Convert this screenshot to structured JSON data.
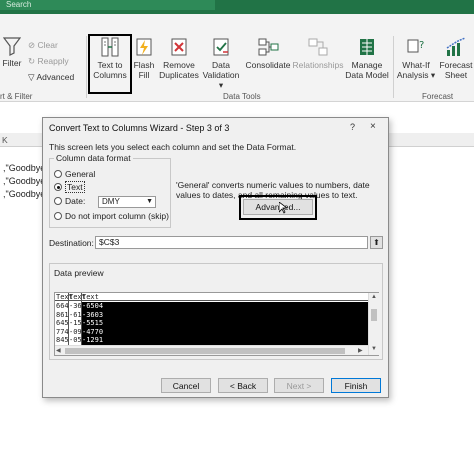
{
  "app": {
    "search_placeholder": "Search",
    "accent": "#217346"
  },
  "ribbon": {
    "filter_label": "Filter",
    "clear_label": "Clear",
    "reapply_label": "Reapply",
    "advanced_label": "Advanced",
    "sort_filter_group": "rt & Filter",
    "text_to_columns_line1": "Text to",
    "text_to_columns_line2": "Columns",
    "flash_fill_line1": "Flash",
    "flash_fill_line2": "Fill",
    "remove_duplicates_line1": "Remove",
    "remove_duplicates_line2": "Duplicates",
    "data_validation_line1": "Data",
    "data_validation_line2": "Validation",
    "consolidate_label": "Consolidate",
    "relationships_label": "Relationships",
    "manage_model_line1": "Manage",
    "manage_model_line2": "Data Model",
    "data_tools_group": "Data Tools",
    "whatif_line1": "What-If",
    "whatif_line2": "Analysis",
    "forecast_sheet_line1": "Forecast",
    "forecast_sheet_line2": "Sheet",
    "forecast_group": "Forecast"
  },
  "sheet": {
    "column_k": "K",
    "rows": [
      ",\"Goodbye",
      ",\"Goodbye",
      ",\"Goodbye"
    ]
  },
  "dialog": {
    "title": "Convert Text to Columns Wizard - Step 3 of 3",
    "help": "?",
    "close": "×",
    "subtitle": "This screen lets you select each column and set the Data Format.",
    "format_group": "Column data format",
    "opt_general": "General",
    "opt_text": "Text",
    "opt_date": "Date:",
    "date_value": "DMY",
    "opt_skip": "Do not import column (skip)",
    "selected_option": "Text",
    "info": "'General' converts numeric values to numbers, date values to dates, and all remaining values to text.",
    "advanced_button": "Advanced...",
    "destination_label": "Destination:",
    "destination_value": "$C$3",
    "preview_label": "Data preview",
    "preview_headers": [
      "Text",
      "Text",
      "Text"
    ],
    "preview_col1": [
      "664",
      "861",
      "645",
      "774",
      "845"
    ],
    "preview_col2": [
      "-36",
      "-61",
      "-15",
      "-09",
      "-05"
    ],
    "preview_col3": [
      "-6504",
      "-3603",
      "-5515",
      "-4770",
      "-1291"
    ],
    "cancel": "Cancel",
    "back": "< Back",
    "next": "Next >",
    "finish": "Finish"
  }
}
